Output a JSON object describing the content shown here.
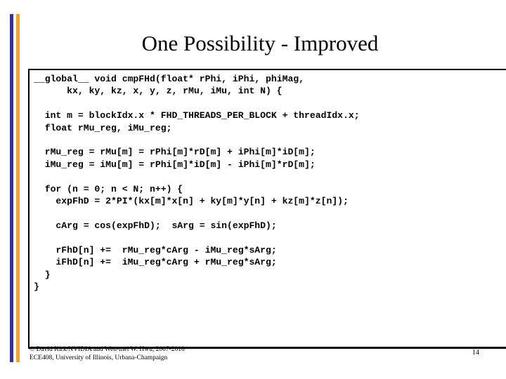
{
  "slide": {
    "title": "One Possibility - Improved",
    "page_number": "14"
  },
  "theme": {
    "bar_blue": "#333399",
    "bar_orange": "#F2A227",
    "text": "#000000",
    "background": "#FFFFFF"
  },
  "code": {
    "language": "cuda-c",
    "lines": [
      "__global__ void cmpFHd(float* rPhi, iPhi, phiMag,",
      "      kx, ky, kz, x, y, z, rMu, iMu, int N) {",
      "",
      "  int m = blockIdx.x * FHD_THREADS_PER_BLOCK + threadIdx.x;",
      "  float rMu_reg, iMu_reg;",
      "",
      "  rMu_reg = rMu[m] = rPhi[m]*rD[m] + iPhi[m]*iD[m];",
      "  iMu_reg = iMu[m] = rPhi[m]*iD[m] - iPhi[m]*rD[m];",
      "",
      "  for (n = 0; n < N; n++) {",
      "    expFhD = 2*PI*(kx[m]*x[n] + ky[m]*y[n] + kz[m]*z[n]);",
      "",
      "    cArg = cos(expFhD);  sArg = sin(expFhD);",
      "",
      "    rFhD[n] +=  rMu_reg*cArg - iMu_reg*sArg;",
      "    iFhD[n] +=  iMu_reg*cArg + rMu_reg*sArg;",
      "  }",
      "}"
    ],
    "text": "__global__ void cmpFHd(float* rPhi, iPhi, phiMag,\n      kx, ky, kz, x, y, z, rMu, iMu, int N) {\n\n  int m = blockIdx.x * FHD_THREADS_PER_BLOCK + threadIdx.x;\n  float rMu_reg, iMu_reg;\n\n  rMu_reg = rMu[m] = rPhi[m]*rD[m] + iPhi[m]*iD[m];\n  iMu_reg = iMu[m] = rPhi[m]*iD[m] - iPhi[m]*rD[m];\n\n  for (n = 0; n < N; n++) {\n    expFhD = 2*PI*(kx[m]*x[n] + ky[m]*y[n] + kz[m]*z[n]);\n\n    cArg = cos(expFhD);  sArg = sin(expFhD);\n\n    rFhD[n] +=  rMu_reg*cArg - iMu_reg*sArg;\n    iFhD[n] +=  iMu_reg*cArg + rMu_reg*sArg;\n  }\n}"
  },
  "footer": {
    "credit_line_1": "© David Kirk/NVIDIA and Wen-mei W. Hwu, 2007-2010",
    "credit_line_2": "ECE408, University of Illinois, Urbana-Champaign",
    "credit": "© David Kirk/NVIDIA and Wen-mei W. Hwu, 2007-2010\nECE408, University of Illinois, Urbana-Champaign"
  }
}
